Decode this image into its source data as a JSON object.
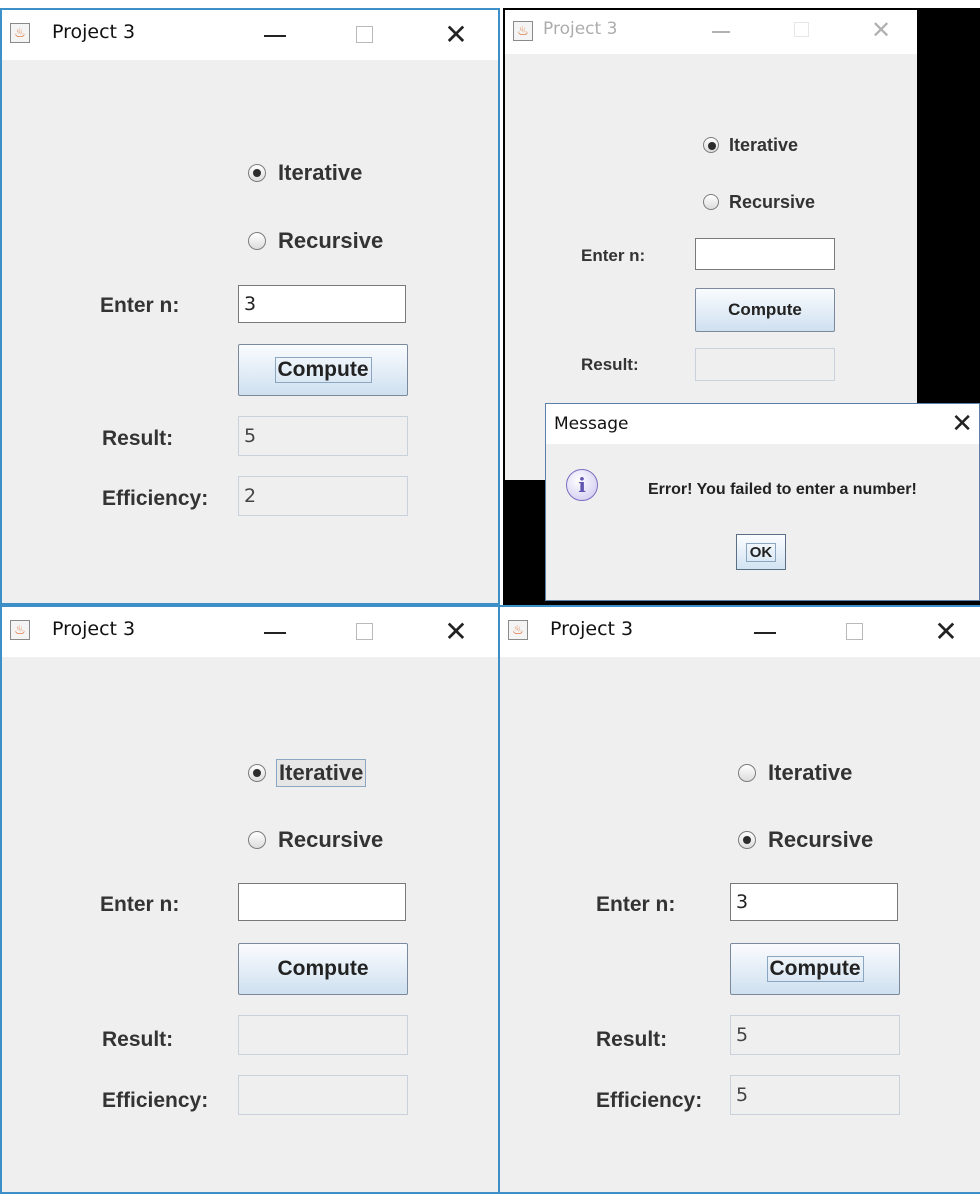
{
  "windows": [
    {
      "title": "Project 3",
      "icon": "java-cup-icon",
      "options": [
        "Iterative",
        "Recursive"
      ],
      "selected": "Iterative",
      "enter_label": "Enter n:",
      "n_value": "3",
      "compute_label": "Compute",
      "result_label": "Result:",
      "result_value": "5",
      "efficiency_label": "Efficiency:",
      "efficiency_value": "2"
    },
    {
      "title": "Project 3",
      "icon": "java-cup-icon",
      "options": [
        "Iterative",
        "Recursive"
      ],
      "selected": "Iterative",
      "enter_label": "Enter n:",
      "n_value": "",
      "compute_label": "Compute",
      "result_label": "Result:",
      "result_value": ""
    },
    {
      "title": "Project 3",
      "icon": "java-cup-icon",
      "options": [
        "Iterative",
        "Recursive"
      ],
      "selected": "Iterative",
      "enter_label": "Enter n:",
      "n_value": "",
      "compute_label": "Compute",
      "result_label": "Result:",
      "result_value": "",
      "efficiency_label": "Efficiency:",
      "efficiency_value": ""
    },
    {
      "title": "Project 3",
      "icon": "java-cup-icon",
      "options": [
        "Iterative",
        "Recursive"
      ],
      "selected": "Recursive",
      "enter_label": "Enter n:",
      "n_value": "3",
      "compute_label": "Compute",
      "result_label": "Result:",
      "result_value": "5",
      "efficiency_label": "Efficiency:",
      "efficiency_value": "5"
    }
  ],
  "message_dialog": {
    "title": "Message",
    "icon": "info-icon",
    "text": "Error! You failed to enter a number!",
    "ok_label": "OK"
  },
  "colors": {
    "window_border": "#3d90c7",
    "window_bg": "#efefef",
    "button_gradient_bottom": "#cfe0f0"
  }
}
